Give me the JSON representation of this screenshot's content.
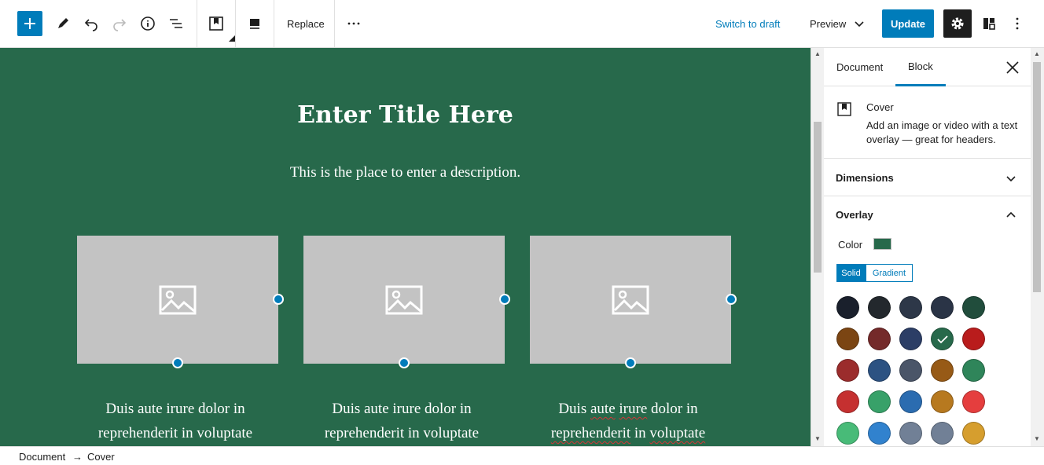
{
  "toolbar": {
    "add_icon": "plus-icon",
    "tools": [
      "pencil-icon",
      "undo-icon",
      "redo-icon",
      "info-icon",
      "list-view-icon"
    ],
    "block_icon": "cover-block-icon",
    "align_icon": "align-icon",
    "replace_label": "Replace",
    "more_icon": "ellipsis-icon",
    "switch_draft_label": "Switch to draft",
    "preview_label": "Preview",
    "update_label": "Update",
    "settings_icon": "gear-icon",
    "plugins_icon": "layout-icon",
    "options_icon": "vertical-ellipsis-icon"
  },
  "canvas": {
    "title": "Enter Title Here",
    "description": "This is the place to enter a description.",
    "columns": [
      {
        "line1": "Duis aute irure dolor in",
        "line2": "reprehenderit in voluptate"
      },
      {
        "line1": "Duis aute irure dolor in",
        "line2": "reprehenderit in voluptate"
      },
      {
        "w1": "Duis",
        "w2": "aute",
        "w3": "irure",
        "w4": "dolor in",
        "w5": "reprehenderit",
        "w6": "in",
        "w7": "voluptate"
      }
    ],
    "background_color": "#27694b"
  },
  "sidebar": {
    "tab_document": "Document",
    "tab_block": "Block",
    "block_title": "Cover",
    "block_description": "Add an image or video with a text overlay — great for headers.",
    "dimensions_label": "Dimensions",
    "overlay_label": "Overlay",
    "color_label": "Color",
    "solid_label": "Solid",
    "gradient_label": "Gradient",
    "palette": [
      "#1a202c",
      "#23282d",
      "#2d3748",
      "#2a3446",
      "#214d3c",
      "#7b4513",
      "#742a2a",
      "#2c3e66",
      "#27694b",
      "#b91c1c",
      "#9b2c2c",
      "#2c5282",
      "#4a5568",
      "#975a16",
      "#2f855a",
      "#c53030",
      "#38a169",
      "#2b6cb0",
      "#b7791f",
      "#e53e3e",
      "#48bb78",
      "#3182ce",
      "#718096",
      "#718096",
      "#d69e2e"
    ],
    "selected_index": 8
  },
  "footer": {
    "crumb_root": "Document",
    "crumb_sep": "→",
    "crumb_current": "Cover"
  }
}
